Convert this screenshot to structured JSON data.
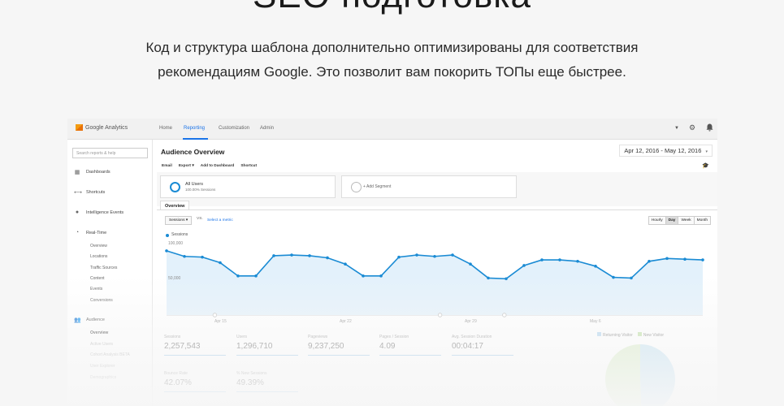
{
  "hero": {
    "title": "SEO подготовка",
    "description_line1": "Код и структура шаблона дополнительно оптимизированы для соответствия",
    "description_line2": "рекомендациям Google. Это позволит вам покорить ТОПы еще быстрее."
  },
  "ga": {
    "logo": "Google Analytics",
    "nav": [
      "Home",
      "Reporting",
      "Customization",
      "Admin"
    ],
    "active_nav": "Reporting",
    "top_icons": [
      "caret-down-icon",
      "gear-icon",
      "bell-icon"
    ],
    "sidebar": {
      "search_placeholder": "Search reports & help",
      "items": [
        {
          "label": "Dashboards",
          "icon": "dashboards-icon"
        },
        {
          "label": "Shortcuts",
          "icon": "shortcuts-icon"
        },
        {
          "label": "Intelligence Events",
          "icon": "intelligence-icon"
        },
        {
          "label": "Real-Time",
          "icon": "realtime-icon"
        },
        {
          "label": "Audience",
          "icon": "audience-icon"
        }
      ],
      "realtime_sub": [
        "Overview",
        "Locations",
        "Traffic Sources",
        "Content",
        "Events",
        "Conversions"
      ],
      "audience_sub": [
        "Overview",
        "Active Users",
        "Cohort Analysis BETA",
        "User Explorer",
        "Demographics"
      ]
    },
    "page_title": "Audience Overview",
    "date_range": "Apr 12, 2016 - May 12, 2016",
    "actions": [
      "Email",
      "Export ▾",
      "Add to Dashboard",
      "Shortcut"
    ],
    "segments": {
      "all_users_label": "All Users",
      "all_users_sub": "100.00% Sessions",
      "add_segment": "+ Add Segment"
    },
    "tab": "Overview",
    "metric_select": "Sessions ▾",
    "vs": "VS.",
    "select_metric": "Select a metric",
    "granularity": [
      "Hourly",
      "Day",
      "Week",
      "Month"
    ],
    "active_granularity": "Day",
    "series_label": "Sessions",
    "y_ticks": [
      "100,000",
      "50,000"
    ],
    "x_ticks": [
      "Apr 15",
      "Apr 22",
      "Apr 29",
      "May 6"
    ],
    "kpis": [
      {
        "label": "Sessions",
        "value": "2,257,543"
      },
      {
        "label": "Users",
        "value": "1,296,710"
      },
      {
        "label": "Pageviews",
        "value": "9,237,250"
      },
      {
        "label": "Pages / Session",
        "value": "4.09"
      },
      {
        "label": "Avg. Session Duration",
        "value": "00:04:17"
      },
      {
        "label": "Bounce Rate",
        "value": "42.07%"
      },
      {
        "label": "% New Sessions",
        "value": "49.39%"
      }
    ],
    "pie_legend": [
      "Returning Visitor",
      "New Visitor"
    ],
    "pie_colors": {
      "returning": "#d7ecc4",
      "new": "#bfe0f2"
    },
    "pie": {
      "returning_pct": 50.6,
      "new_pct": 49.4
    }
  },
  "chart_data": {
    "type": "area",
    "series": [
      {
        "name": "Sessions",
        "values": [
          92000,
          84000,
          83000,
          75000,
          56000,
          56000,
          85000,
          86000,
          85000,
          82000,
          73000,
          56000,
          56000,
          83000,
          86000,
          84000,
          86000,
          73000,
          53000,
          52000,
          71000,
          79000,
          79000,
          77000,
          70000,
          54000,
          53000,
          77000,
          81000,
          80000,
          79000
        ]
      }
    ],
    "x_start": "2016-04-12",
    "x_ticks": [
      "Apr 15",
      "Apr 22",
      "Apr 29",
      "May 6"
    ],
    "ylim": [
      0,
      100000
    ],
    "color": "#1a8bd4"
  }
}
